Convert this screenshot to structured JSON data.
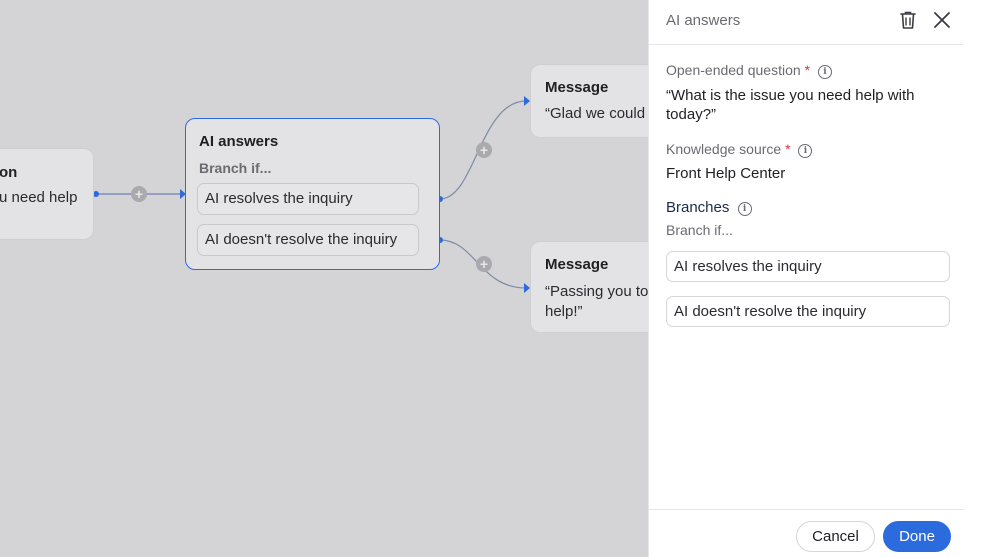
{
  "canvas": {
    "node_left": {
      "title": "on",
      "text": "u need help"
    },
    "node_ai": {
      "title": "AI answers",
      "branch_label": "Branch if...",
      "branch1": "AI resolves the inquiry",
      "branch2": "AI doesn't resolve the inquiry"
    },
    "node_msg1": {
      "title": "Message",
      "text": "“Glad we could"
    },
    "node_msg2": {
      "title": "Message",
      "text_line1": "“Passing you to",
      "text_line2": "help!”"
    },
    "plus_symbol": "+"
  },
  "panel": {
    "title": "AI answers",
    "question": {
      "label": "Open-ended question",
      "required_mark": "*",
      "value": "“What is the issue you need help with today?”"
    },
    "knowledge": {
      "label": "Knowledge source",
      "required_mark": "*",
      "value": "Front Help Center"
    },
    "branches": {
      "title": "Branches",
      "sub": "Branch if...",
      "items": [
        "AI resolves the inquiry",
        "AI doesn't resolve the inquiry"
      ]
    },
    "info_glyph": "i",
    "footer": {
      "cancel": "Cancel",
      "done": "Done"
    }
  },
  "colors": {
    "accent": "#2c6bde",
    "required": "#d4363d",
    "canvas_bg": "#d4d4d6"
  },
  "icons": [
    "trash-icon",
    "close-icon",
    "info-icon",
    "plus-icon"
  ]
}
